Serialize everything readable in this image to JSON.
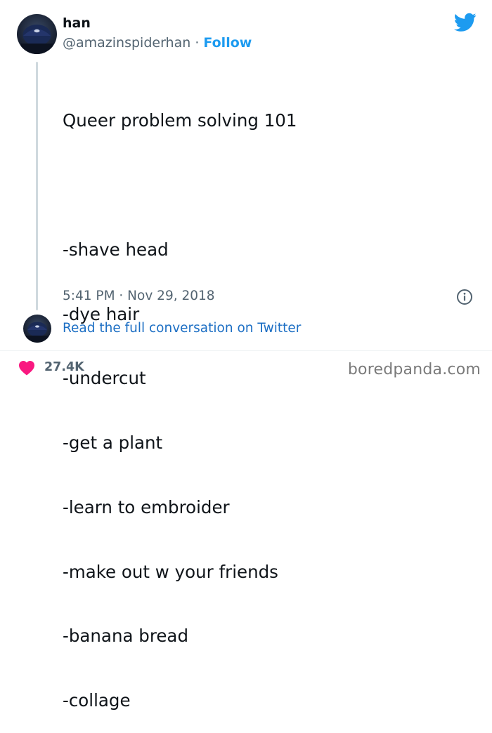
{
  "tweet": {
    "author": {
      "name": "han",
      "handle": "@amazinspiderhan",
      "separator": "·",
      "follow_label": "Follow"
    },
    "lines": [
      "Queer problem solving 101",
      "",
      "-shave head",
      "-dye hair",
      "-undercut",
      "-get a plant",
      "-learn to embroider",
      "-make out w your friends",
      "-banana bread",
      "-collage"
    ],
    "timestamp": "5:41 PM · Nov 29, 2018",
    "read_more_label": "Read the full conversation on Twitter",
    "likes": "27.4K"
  },
  "watermark": "boredpanda.com",
  "icons": {
    "brand": "twitter-bird-icon",
    "info": "info-icon",
    "like": "heart-icon"
  },
  "colors": {
    "link": "#1d9bf0",
    "heart": "#f91880",
    "muted": "#536471"
  }
}
